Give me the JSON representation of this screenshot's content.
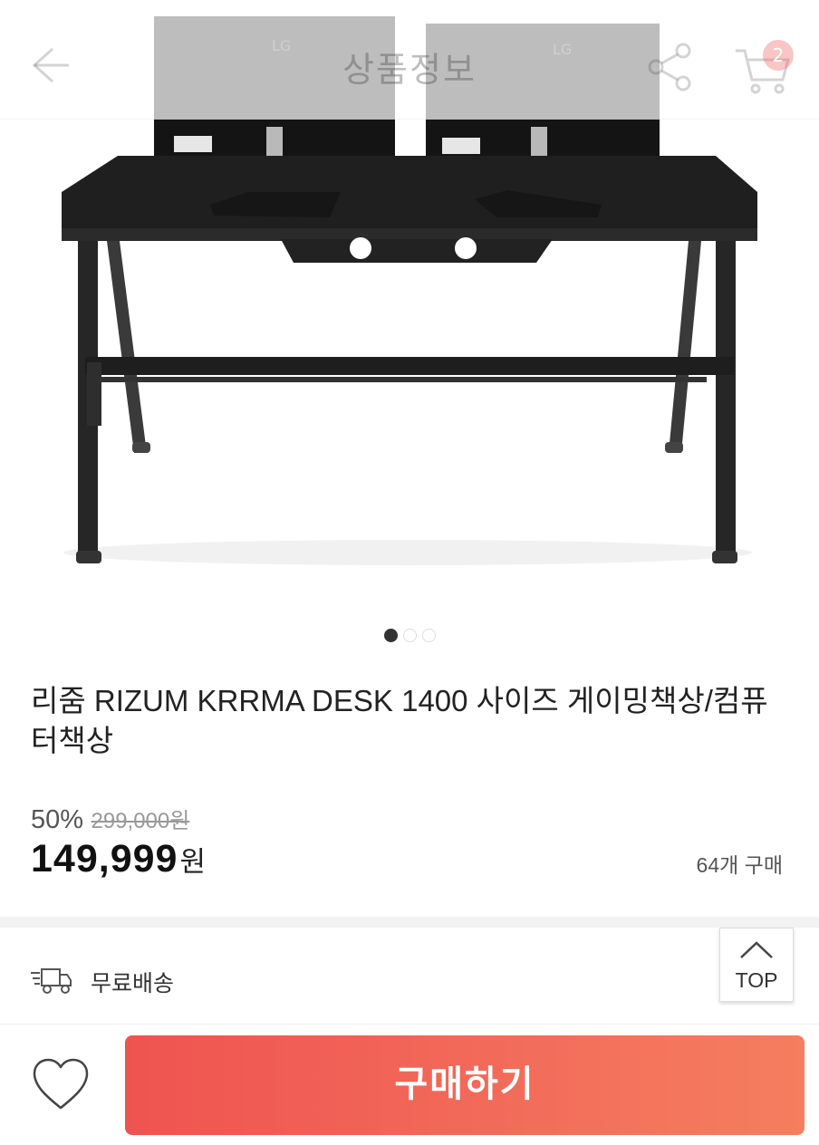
{
  "header": {
    "title": "상품정보",
    "cart_count": "2",
    "icons": [
      "back-arrow-icon",
      "share-icon",
      "cart-icon"
    ]
  },
  "gallery": {
    "slide_count": 3,
    "active_index": 0
  },
  "product": {
    "name": "리줌 RIZUM KRRMA DESK 1400 사이즈 게이밍책상/컴퓨터책상",
    "discount_rate": "50%",
    "original_price": "299,000원",
    "price": "149,999",
    "currency": "원",
    "sold_count": "64개 구매"
  },
  "shipping": {
    "label": "무료배송",
    "icon": "delivery-truck-icon"
  },
  "top_button": {
    "label": "TOP"
  },
  "bottom_bar": {
    "wishlist_icon": "heart-icon",
    "buy_label": "구매하기"
  },
  "colors": {
    "buy_gradient_start": "#ef5350",
    "buy_gradient_end": "#f57e5e"
  }
}
